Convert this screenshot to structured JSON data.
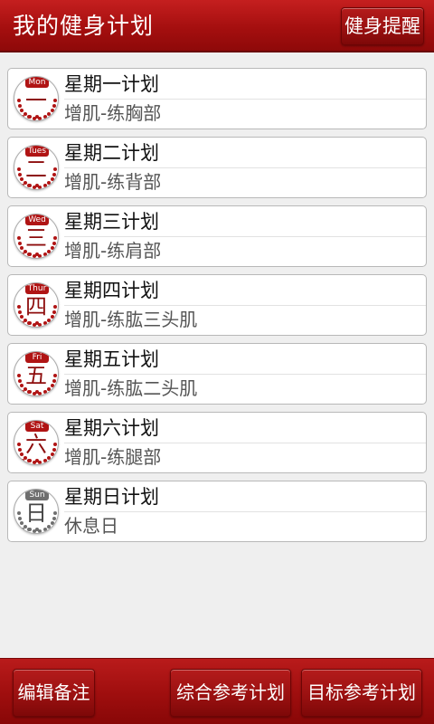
{
  "header": {
    "title": "我的健身计划",
    "remind_button": "健身提醒"
  },
  "plans": [
    {
      "day_tab": "Mon",
      "day_char": "一",
      "title": "星期一计划",
      "subtitle": "增肌-练胸部"
    },
    {
      "day_tab": "Tues",
      "day_char": "二",
      "title": "星期二计划",
      "subtitle": "增肌-练背部"
    },
    {
      "day_tab": "Wed",
      "day_char": "三",
      "title": "星期三计划",
      "subtitle": "增肌-练肩部"
    },
    {
      "day_tab": "Thur",
      "day_char": "四",
      "title": "星期四计划",
      "subtitle": "增肌-练肱三头肌"
    },
    {
      "day_tab": "Fri",
      "day_char": "五",
      "title": "星期五计划",
      "subtitle": "增肌-练肱二头肌"
    },
    {
      "day_tab": "Sat",
      "day_char": "六",
      "title": "星期六计划",
      "subtitle": "增肌-练腿部"
    },
    {
      "day_tab": "Sun",
      "day_char": "日",
      "title": "星期日计划",
      "subtitle": "休息日"
    }
  ],
  "footer": {
    "edit_notes": "编辑备注",
    "general_plan": "综合参考计划",
    "target_plan": "目标参考计划"
  },
  "colors": {
    "brand_red": "#a50f0f",
    "rest_day_gray": "#6f6f6f"
  }
}
